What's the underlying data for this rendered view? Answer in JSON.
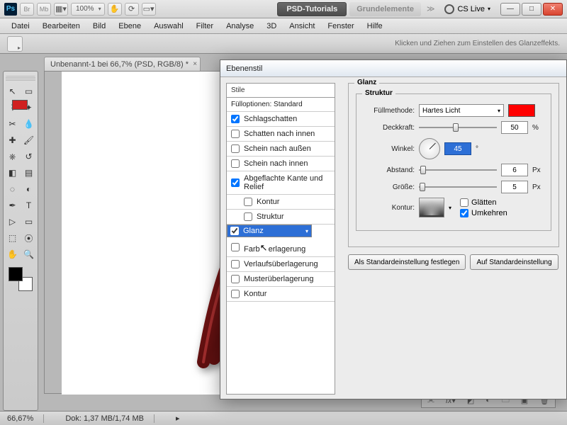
{
  "appbar": {
    "zoom": "100%",
    "btn_psd": "PSD-Tutorials",
    "btn_grund": "Grundelemente",
    "cslive": "CS Live"
  },
  "menu": [
    "Datei",
    "Bearbeiten",
    "Bild",
    "Ebene",
    "Auswahl",
    "Filter",
    "Analyse",
    "3D",
    "Ansicht",
    "Fenster",
    "Hilfe"
  ],
  "optsHint": "Klicken und Ziehen zum Einstellen des Glanzeffekts.",
  "doc_tab": "Unbenannt-1 bei 66,7% (PSD, RGB/8) *",
  "status": {
    "zoom": "66,67%",
    "dok": "Dok: 1,37 MB/1,74 MB"
  },
  "dialog": {
    "title": "Ebenenstil",
    "styles_hdr": "Stile",
    "fillopt": "Fülloptionen: Standard",
    "items": {
      "schlagschatten": "Schlagschatten",
      "schatten_innen": "Schatten nach innen",
      "schein_aussen": "Schein nach außen",
      "schein_innen": "Schein nach innen",
      "abgeflachte": "Abgeflachte Kante und Relief",
      "kontur_sub": "Kontur",
      "struktur_sub": "Struktur",
      "glanz": "Glanz",
      "farbueber": "Farbüberlagerung",
      "verlauf": "Verlaufsüberlagerung",
      "muster": "Musterüberlagerung",
      "kontur": "Kontur"
    },
    "right": {
      "glanz_legend": "Glanz",
      "struktur_legend": "Struktur",
      "fuellmethode_lbl": "Füllmethode:",
      "fuellmethode_val": "Hartes Licht",
      "deckkraft_lbl": "Deckkraft:",
      "deckkraft_val": "50",
      "winkel_lbl": "Winkel:",
      "winkel_val": "45",
      "abstand_lbl": "Abstand:",
      "abstand_val": "6",
      "groesse_lbl": "Größe:",
      "groesse_val": "5",
      "kontur_lbl": "Kontur:",
      "glaetten": "Glätten",
      "umkehren": "Umkehren",
      "px": "Px",
      "pct": "%",
      "deg": "°",
      "btn_standard": "Als Standardeinstellung festlegen",
      "btn_reset": "Auf Standardeinstellung"
    }
  }
}
